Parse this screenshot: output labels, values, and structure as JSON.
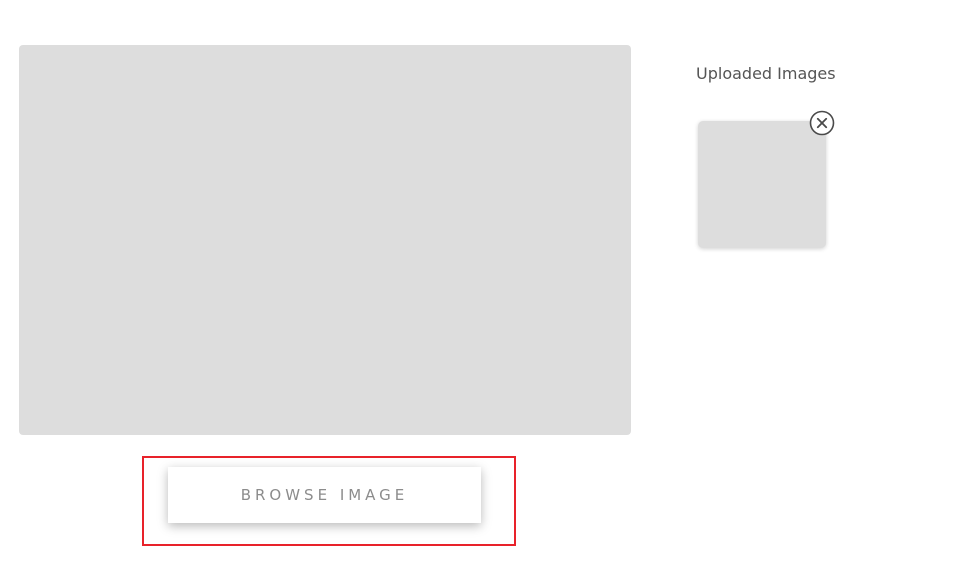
{
  "upload": {
    "browse_button_label": "BROWSE IMAGE"
  },
  "uploaded_images": {
    "title": "Uploaded Images",
    "items": [
      {
        "remove_icon": "close-circle-icon"
      }
    ]
  },
  "colors": {
    "placeholder": "#dddddd",
    "highlight": "#e8222a",
    "button_text": "#8c8c8c",
    "title_text": "#555555"
  }
}
